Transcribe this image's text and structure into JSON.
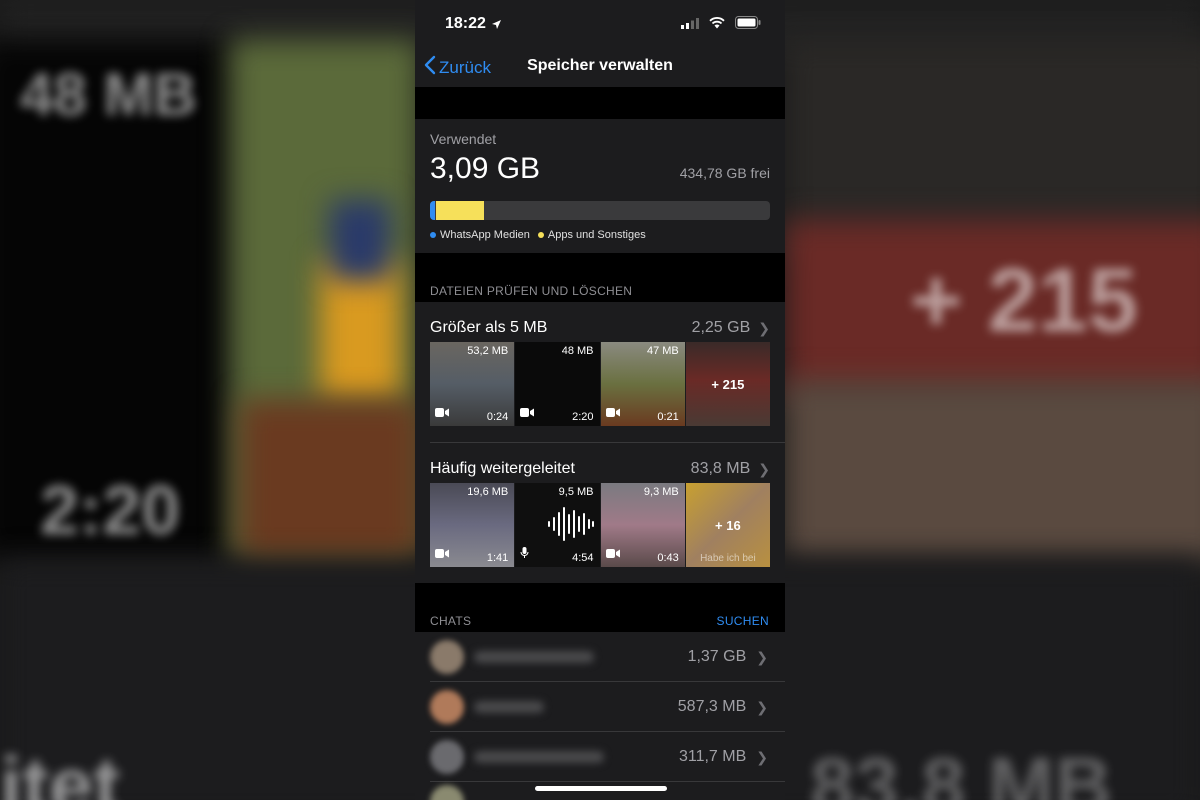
{
  "status_bar": {
    "time": "18:22"
  },
  "nav": {
    "back_label": "Zurück",
    "title": "Speicher verwalten"
  },
  "storage": {
    "used_label": "Verwendet",
    "used_value": "3,09 GB",
    "free": "434,78 GB frei",
    "legend": [
      {
        "label": "WhatsApp Medien",
        "color": "#2f8cf1"
      },
      {
        "label": "Apps und Sonstiges",
        "color": "#f6e05a"
      }
    ]
  },
  "files_section": {
    "header": "DATEIEN PRÜFEN UND LÖSCHEN",
    "groups": [
      {
        "title": "Größer als 5 MB",
        "value": "2,25 GB",
        "thumbs": [
          {
            "size": "53,2 MB",
            "duration": "0:24",
            "icon": "video-icon"
          },
          {
            "size": "48 MB",
            "duration": "2:20",
            "icon": "video-icon"
          },
          {
            "size": "47 MB",
            "duration": "0:21",
            "icon": "video-icon"
          },
          {
            "more": "+ 215"
          }
        ]
      },
      {
        "title": "Häufig weitergeleitet",
        "value": "83,8 MB",
        "thumbs": [
          {
            "size": "19,6 MB",
            "duration": "1:41",
            "icon": "video-icon"
          },
          {
            "size": "9,5 MB",
            "duration": "4:54",
            "icon": "microphone-icon"
          },
          {
            "size": "9,3 MB",
            "duration": "0:43",
            "icon": "video-icon"
          },
          {
            "more": "+ 16",
            "caption": "Habe ich bei"
          }
        ]
      }
    ]
  },
  "chats_section": {
    "header": "CHATS",
    "action": "SUCHEN",
    "rows": [
      {
        "size": "1,37 GB"
      },
      {
        "size": "587,3 MB"
      },
      {
        "size": "311,7 MB"
      }
    ]
  },
  "background": {
    "left_text": "48 MB",
    "center_text": "2:20",
    "right_text": "+ 215",
    "bottom_left": "itet",
    "bottom_right": "83,8 MB"
  }
}
